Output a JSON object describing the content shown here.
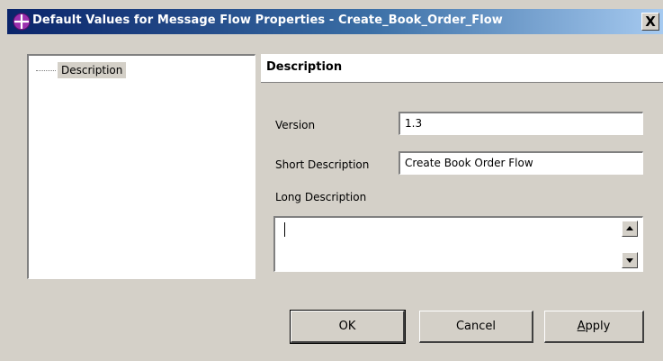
{
  "window": {
    "title": "Default Values for Message Flow Properties - Create_Book_Order_Flow",
    "close_glyph": "X",
    "icon": "message-flow-icon"
  },
  "tree": {
    "items": [
      {
        "label": "Description",
        "selected": true
      }
    ]
  },
  "panel": {
    "header": "Description",
    "fields": {
      "version": {
        "label": "Version",
        "value": "1.3"
      },
      "short_description": {
        "label": "Short Description",
        "value": "Create Book Order Flow"
      },
      "long_description": {
        "label": "Long Description",
        "value": ""
      }
    }
  },
  "buttons": {
    "ok": "OK",
    "cancel": "Cancel",
    "apply_first": "A",
    "apply_rest": "pply"
  },
  "colors": {
    "dialog_bg": "#d4d0c8",
    "title_start": "#0a246a",
    "title_end": "#a6caf0",
    "icon_purple": "#9b2fae"
  }
}
